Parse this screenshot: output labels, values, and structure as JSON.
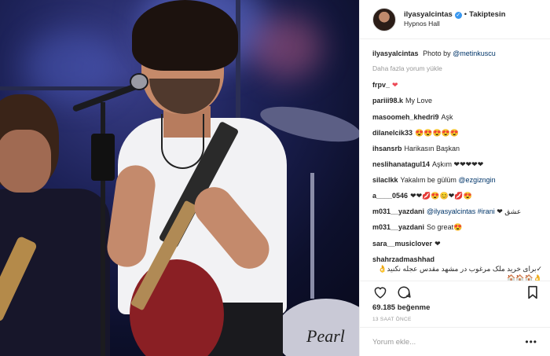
{
  "header": {
    "username": "ilyasyalcintas",
    "separator": "•",
    "follow_status": "Takiptesin",
    "location": "Hypnos Hall"
  },
  "caption": {
    "user": "ilyasyalcintas",
    "text": "Photo by",
    "mention": "@metinkuscu"
  },
  "load_more": "Daha fazla yorum yükle",
  "comments": [
    {
      "user": "frpv_",
      "text": "❤"
    },
    {
      "user": "pariii98.k",
      "text": "My Love"
    },
    {
      "user": "masoomeh_khedri9",
      "text": "Aşk"
    },
    {
      "user": "dilanelcik33",
      "text": "😍😍😍😍😍"
    },
    {
      "user": "ihsansrb",
      "text": "Harikasın Başkan"
    },
    {
      "user": "neslihanatagul14",
      "text": "Aşkım ❤❤❤❤❤"
    },
    {
      "user": "silaclkk",
      "text": "Yakalım be gülüm",
      "mention": "@ezgizngin"
    },
    {
      "user": "a____0546",
      "text": "❤❤💋😍😊❤💋😍"
    },
    {
      "user": "m031__yazdani",
      "mention": "@ilyasyalcintas",
      "hashtag": "#irani",
      "text": "❤ عشق"
    },
    {
      "user": "m031__yazdani",
      "text": "So great😍"
    },
    {
      "user": "sara__musiclover",
      "text": "❤"
    },
    {
      "user": "shahrzadmashhad",
      "text": "✓برای خرید ملک مرغوب در مشهد مقدس عجله نکنید👌👌🏠🏠🏠"
    }
  ],
  "likes": "69.185 beğenme",
  "timestamp": "13 SAAT ÖNCE",
  "add_comment_placeholder": "Yorum ekle...",
  "more_label": "•••",
  "photo": {
    "drum_brand": "Pearl"
  },
  "icons": {
    "like": "heart-outline-icon",
    "comment": "speech-bubble-icon",
    "save": "bookmark-icon",
    "verified": "verified-badge-icon",
    "more": "more-dots-icon"
  },
  "colors": {
    "verified": "#3897f0",
    "link": "#003569",
    "muted": "#999999",
    "text": "#262626"
  }
}
